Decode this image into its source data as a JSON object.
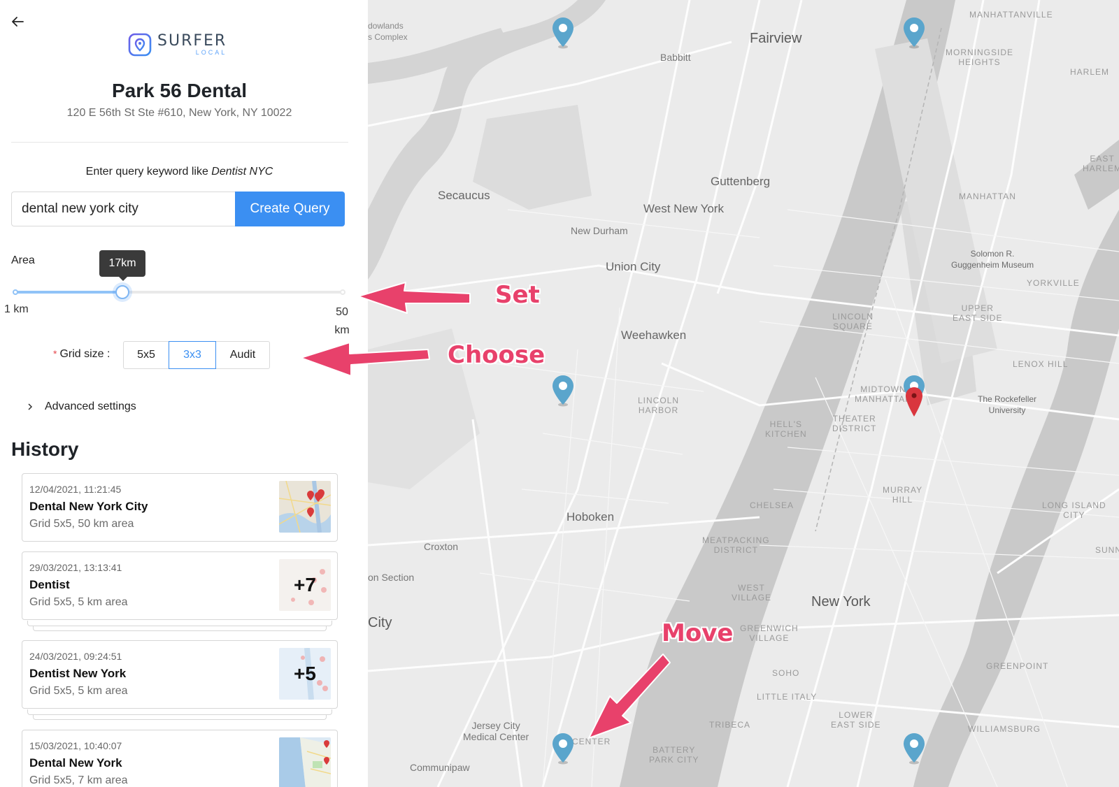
{
  "business": {
    "name": "Park 56 Dental",
    "address": "120 E 56th St Ste #610, New York, NY 10022"
  },
  "logo": {
    "word": "SURFER",
    "sub": "LOCAL"
  },
  "query": {
    "hint_prefix": "Enter query keyword like ",
    "hint_example": "Dentist NYC",
    "value": "dental new york city",
    "button_label": "Create Query"
  },
  "area": {
    "label": "Area",
    "value_label": "17km",
    "value_km": 17,
    "min_label": "1 km",
    "max_label": "50 km",
    "min_km": 1,
    "max_km": 50
  },
  "grid": {
    "label": "Grid size :",
    "options": [
      "5x5",
      "3x3",
      "Audit"
    ],
    "selected": "3x3"
  },
  "advanced": {
    "label": "Advanced settings"
  },
  "history": {
    "title": "History",
    "items": [
      {
        "date": "12/04/2021, 11:21:45",
        "title": "Dental New York City",
        "sub": "Grid 5x5, 50 km area",
        "count": ""
      },
      {
        "date": "29/03/2021, 13:13:41",
        "title": "Dentist",
        "sub": "Grid 5x5, 5 km area",
        "count": "+7"
      },
      {
        "date": "24/03/2021, 09:24:51",
        "title": "Dentist New York",
        "sub": "Grid 5x5, 5 km area",
        "count": "+5"
      },
      {
        "date": "15/03/2021, 10:40:07",
        "title": "Dental New York",
        "sub": "Grid 5x5, 7 km area",
        "count": ""
      }
    ]
  },
  "annotations": {
    "set": "Set",
    "choose": "Choose",
    "move": "Move"
  },
  "map": {
    "labels": {
      "fairview": "Fairview",
      "babbitt": "Babbitt",
      "secaucus": "Secaucus",
      "guttenberg": "Guttenberg",
      "west_new_york": "West New York",
      "new_durham": "New Durham",
      "union_city": "Union City",
      "weehawken": "Weehawken",
      "hoboken": "Hoboken",
      "croxton": "Croxton",
      "new_york": "New York",
      "jersey_city": "City",
      "jersey_city_medical": "Jersey City\nMedical Center",
      "communipaw": "Communipaw",
      "manhattanville": "MANHATTANVILLE",
      "morningside": "MORNINGSIDE\nHEIGHTS",
      "harlem": "HARLEM",
      "east_harlem": "EAST\nHARLEM",
      "manhattan": "MANHATTAN",
      "guggenheim": "Solomon R.\nGuggenheim Museum",
      "yorkville": "YORKVILLE",
      "upper_east": "UPPER\nEAST SIDE",
      "lincoln_square": "LINCOLN\nSQUARE",
      "lenox_hill": "LENOX HILL",
      "rockefeller": "The Rockefeller\nUniversity",
      "midtown": "MIDTOWN\nMANHATTAN",
      "theater": "THEATER\nDISTRICT",
      "hells_kitchen": "HELL'S\nKITCHEN",
      "lincoln_harbor": "LINCOLN\nHARBOR",
      "murray_hill": "MURRAY\nHILL",
      "chelsea": "CHELSEA",
      "meatpacking": "MEATPACKING\nDISTRICT",
      "west_village": "WEST\nVILLAGE",
      "greenwich": "GREENWICH\nVILLAGE",
      "soho": "SOHO",
      "little_italy": "LITTLE ITALY",
      "tribeca": "TRIBECA",
      "lower_east": "LOWER\nEAST SIDE",
      "battery_park": "BATTERY\nPARK CITY",
      "long_island_city": "LONG ISLAND\nCITY",
      "greenpoint": "GREENPOINT",
      "williamsburg": "WILLIAMSBURG",
      "sunnyside": "SUNN",
      "lowlands": "dowlands\ns Complex",
      "on_section": "on Section",
      "center": "CENTER"
    }
  }
}
